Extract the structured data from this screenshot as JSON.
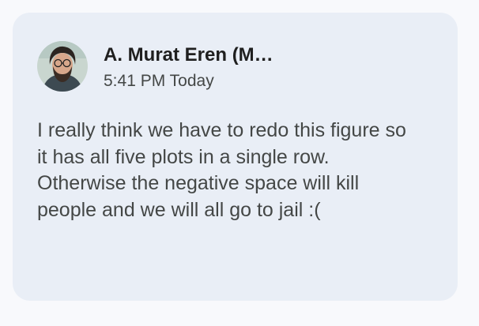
{
  "comment": {
    "author": "A. Murat Eren (M…",
    "timestamp": "5:41 PM Today",
    "avatar_icon": "user-avatar-photo",
    "text": "I really think we have to redo this figure so it has all five plots in a single row. Otherwise the negative space will kill people and we will all go to jail :("
  },
  "colors": {
    "page_background": "#f8f9fc",
    "card_background": "#e9eef6",
    "author_text": "#1f1f1f",
    "secondary_text": "#444746"
  }
}
